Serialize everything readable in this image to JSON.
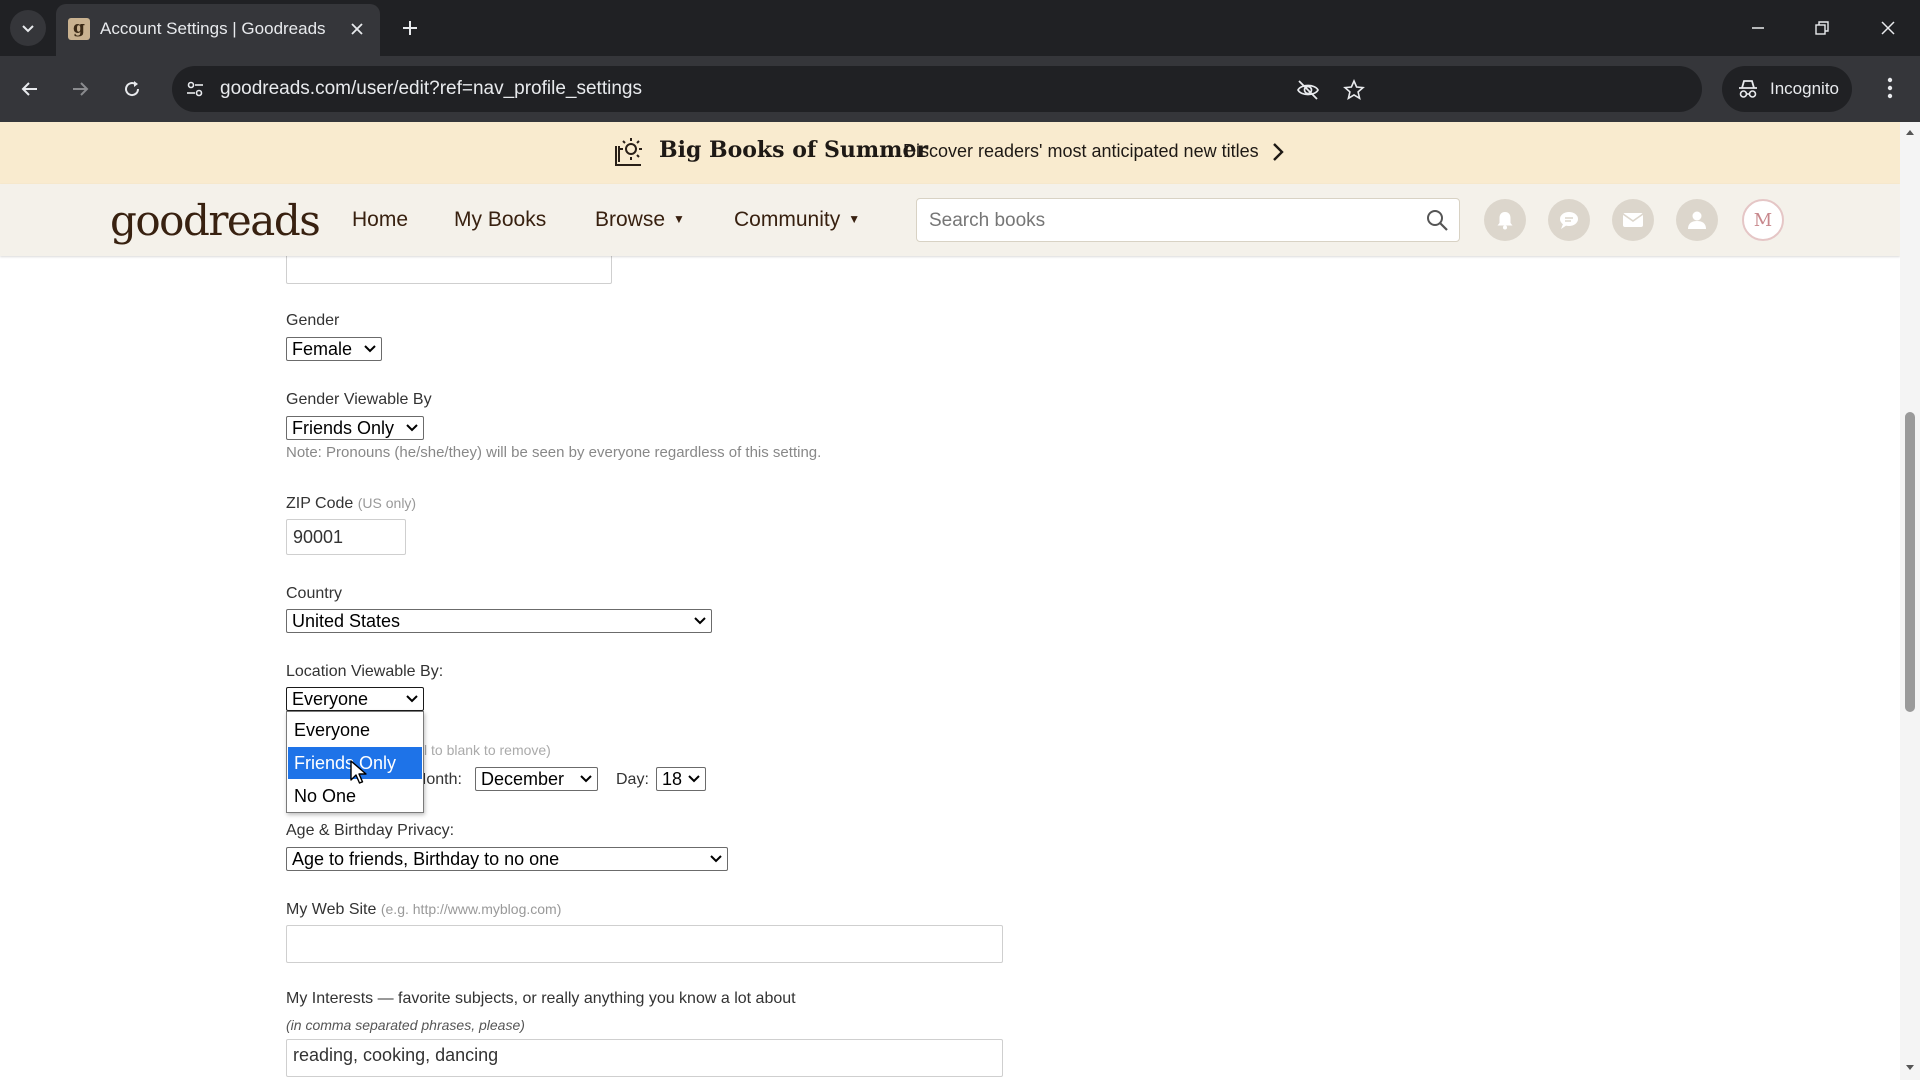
{
  "browser": {
    "tab_title": "Account Settings | Goodreads",
    "favicon_letter": "g",
    "url": "goodreads.com/user/edit?ref=nav_profile_settings",
    "incognito_label": "Incognito"
  },
  "banner": {
    "title": "Big Books of Summer",
    "subtitle": "Discover readers' most anticipated new titles"
  },
  "site_nav": {
    "logo": "goodreads",
    "links": {
      "home": "Home",
      "my_books": "My Books",
      "browse": "Browse",
      "community": "Community"
    },
    "search_placeholder": "Search books",
    "avatar_letter": "M"
  },
  "form": {
    "gender": {
      "label": "Gender",
      "value": "Female"
    },
    "gender_viewable": {
      "label": "Gender Viewable By",
      "value": "Friends Only",
      "note": "Note: Pronouns (he/she/they) will be seen by everyone regardless of this setting."
    },
    "zip": {
      "label": "ZIP Code",
      "hint": "(US only)",
      "value": "90001"
    },
    "country": {
      "label": "Country",
      "value": "United States"
    },
    "location_viewable": {
      "label": "Location Viewable By:",
      "value": "Everyone",
      "options": [
        "Everyone",
        "Friends Only",
        "No One"
      ],
      "highlighted": "Friends Only"
    },
    "birthday": {
      "hint_partial": "l to blank to remove)",
      "month_label": "Month:",
      "month_value": "December",
      "day_label": "Day:",
      "day_value": "18"
    },
    "age_privacy": {
      "label": "Age & Birthday Privacy:",
      "value": "Age to friends, Birthday to no one"
    },
    "website": {
      "label": "My Web Site",
      "hint": "(e.g. http://www.myblog.com)",
      "value": ""
    },
    "interests": {
      "label": "My Interests — favorite subjects, or really anything you know a lot about",
      "note": "(in comma separated phrases, please)",
      "value": "reading, cooking, dancing"
    }
  },
  "colors": {
    "banner_bg": "#f9ebcf",
    "nav_bg": "#f4f1ea",
    "brand_brown": "#382110",
    "option_highlight": "#1e73e8"
  }
}
